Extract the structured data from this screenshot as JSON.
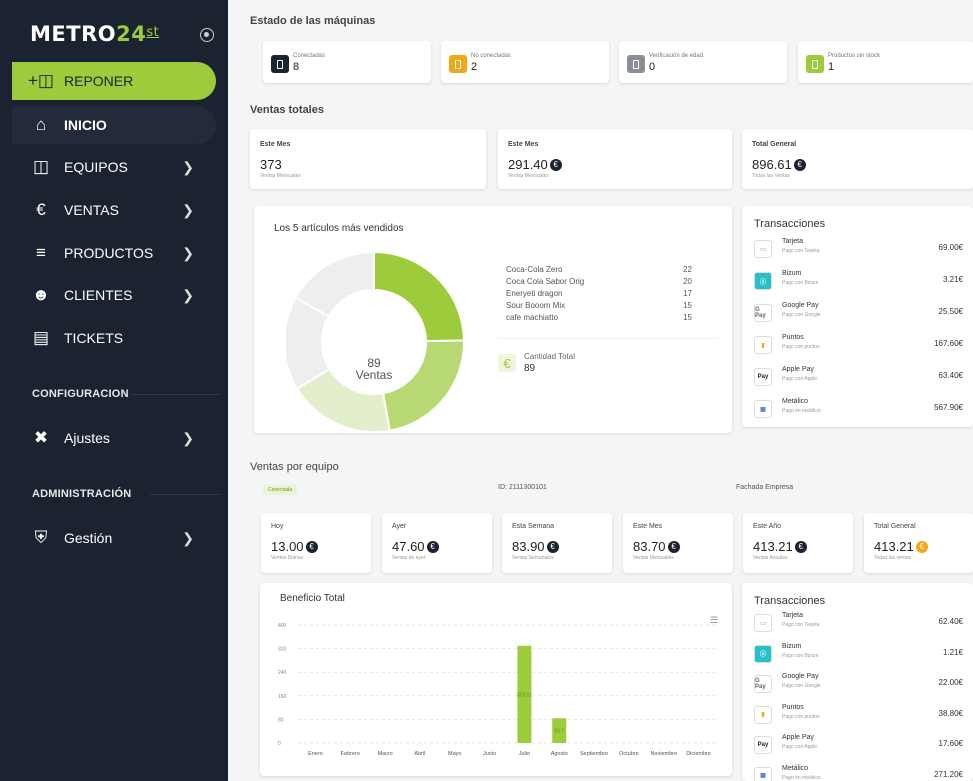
{
  "sidebar": {
    "brand": {
      "text": "METRO",
      "num": "24",
      "sup": "st"
    },
    "reponer": "REPONER",
    "inicio": "INICIO",
    "equipos": "EQUIPOS",
    "ventas": "VENTAS",
    "productos": "PRODUCTOS",
    "clientes": "CLIENTES",
    "tickets": "TICKETS",
    "configuracion": "CONFIGURACION",
    "ajustes": "Ajustes",
    "administracion": "ADMINISTRACIÓN",
    "gestion": "Gestión"
  },
  "estado": {
    "title": "Estado de las máquinas",
    "cards": [
      {
        "label": "Conectadas",
        "value": "8",
        "color": "#1b2230"
      },
      {
        "label": "No conectadas",
        "value": "2",
        "color": "#f2a718"
      },
      {
        "label": "Verificación de edad",
        "value": "0",
        "color": "#8a8f97"
      },
      {
        "label": "Productos sin stock",
        "value": "1",
        "color": "#9ccc3b"
      }
    ]
  },
  "ventas_totales": {
    "title": "Ventas totales",
    "cards": [
      {
        "label": "Este Mes",
        "value": "373",
        "sub": "Ventas Mensuales"
      },
      {
        "label": "Este Mes",
        "value": "291.40",
        "sub": "Ventas Mensuales"
      },
      {
        "label": "Total General",
        "value": "896.61",
        "sub": "Todas las Ventas"
      }
    ]
  },
  "top5": {
    "title": "Los 5 artículos más vendidos",
    "center_value": "89",
    "center_label": "Ventas",
    "items": [
      {
        "name": "Coca-Cola Zero",
        "qty": "22"
      },
      {
        "name": "Coca Cola Sabor Orig",
        "qty": "20"
      },
      {
        "name": "Eneryeti dragon",
        "qty": "17"
      },
      {
        "name": "Sour Booom Mix",
        "qty": "15"
      },
      {
        "name": "cafe machiatto",
        "qty": "15"
      }
    ],
    "total_label": "Cantidad Total",
    "total_value": "89"
  },
  "transacciones1": {
    "title": "Transacciones",
    "rows": [
      {
        "name": "Tarjeta",
        "sub": "Pago con Tarjeta",
        "amount": "69.00€",
        "icon": "card-icon"
      },
      {
        "name": "Bizum",
        "sub": "Pago con Bizum",
        "amount": "3.21€",
        "icon": "bizum-icon"
      },
      {
        "name": "Google Pay",
        "sub": "Pago con Google",
        "amount": "25.50€",
        "icon": "gpay-icon"
      },
      {
        "name": "Puntos",
        "sub": "Pago con puntos",
        "amount": "167.60€",
        "icon": "points-icon"
      },
      {
        "name": "Apple Pay",
        "sub": "Pago con Apple",
        "amount": "63.40€",
        "icon": "applepay-icon"
      },
      {
        "name": "Metálico",
        "sub": "Pago en metálico",
        "amount": "567.90€",
        "icon": "cash-icon"
      }
    ]
  },
  "ventas_equipo": {
    "title": "Ventas por equipo",
    "status": "Conectada",
    "id": "ID: 2111300101",
    "location": "Fachada Empresa",
    "cards": [
      {
        "label": "Hoy",
        "value": "13.00",
        "sub": "Ventas Diarias"
      },
      {
        "label": "Ayer",
        "value": "47.60",
        "sub": "Ventas de ayer"
      },
      {
        "label": "Esta Semana",
        "value": "83.90",
        "sub": "Ventas Semanales"
      },
      {
        "label": "Este Mes",
        "value": "83.70",
        "sub": "Ventas Mensuales"
      },
      {
        "label": "Este Año",
        "value": "413.21",
        "sub": "Ventas Anuales"
      },
      {
        "label": "Total General",
        "value": "413.21",
        "sub": "Todas las ventas"
      }
    ]
  },
  "chart_data": {
    "type": "bar",
    "title": "Beneficio Total",
    "categories": [
      "Enero",
      "Febrero",
      "Marzo",
      "Abril",
      "Mayo",
      "Junio",
      "Julio",
      "Agosto",
      "Septiembre",
      "Octubre",
      "Noviembre",
      "Diciembre"
    ],
    "values": [
      0,
      0,
      0,
      0,
      0,
      0,
      329.51,
      83.7,
      0,
      0,
      0,
      0
    ],
    "data_labels": [
      "",
      "",
      "",
      "",
      "",
      "",
      "329.51",
      "83.7",
      "",
      "",
      "",
      ""
    ],
    "yticks": [
      "400",
      "320",
      "240",
      "160",
      "80",
      "0"
    ],
    "ylim": [
      0,
      400
    ],
    "color": "#9ccc3b"
  },
  "transacciones2": {
    "title": "Transacciones",
    "rows": [
      {
        "name": "Tarjeta",
        "sub": "Pago con Tarjeta",
        "amount": "62.40€",
        "icon": "card-icon"
      },
      {
        "name": "Bizum",
        "sub": "Pago con Bizum",
        "amount": "1.21€",
        "icon": "bizum-icon"
      },
      {
        "name": "Google Pay",
        "sub": "Pago con Google",
        "amount": "22.00€",
        "icon": "gpay-icon"
      },
      {
        "name": "Puntos",
        "sub": "Pago con puntos",
        "amount": "38.80€",
        "icon": "points-icon"
      },
      {
        "name": "Apple Pay",
        "sub": "Pago con Apple",
        "amount": "17.60€",
        "icon": "applepay-icon"
      },
      {
        "name": "Metálico",
        "sub": "Pago en metálico",
        "amount": "271.20€",
        "icon": "cash-icon"
      }
    ]
  }
}
